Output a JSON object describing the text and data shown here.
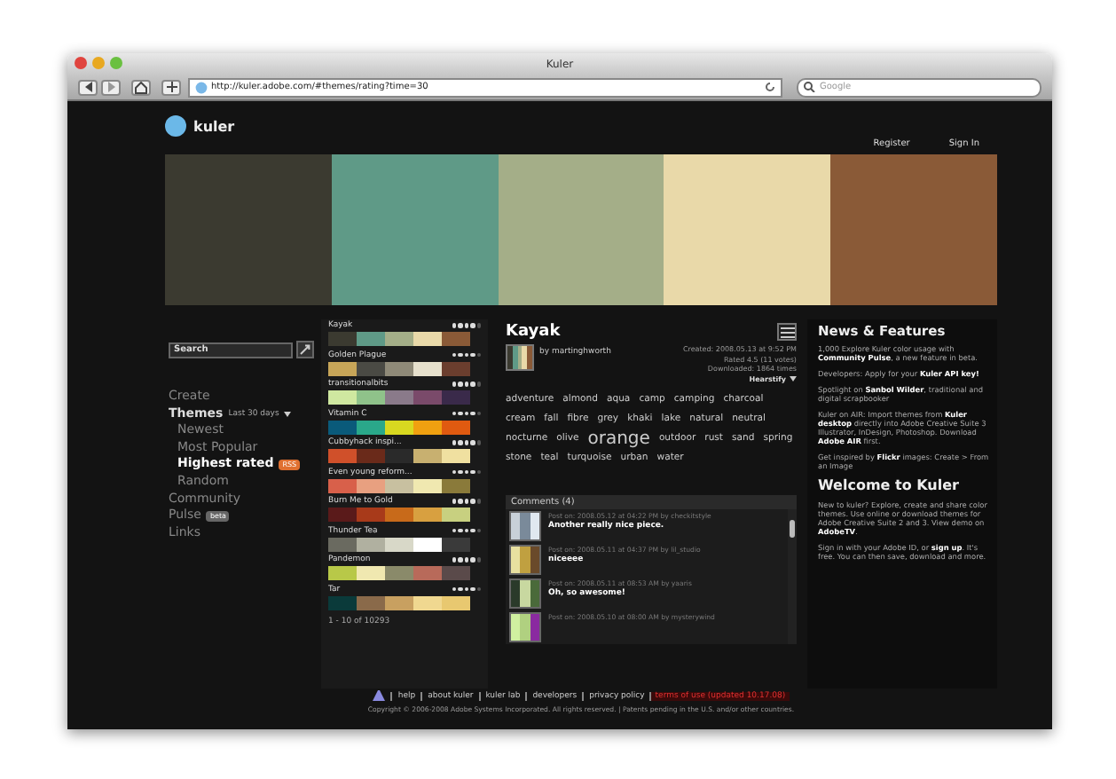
{
  "window": {
    "title": "Kuler"
  },
  "toolbar": {
    "url": "http://kuler.adobe.com/#themes/rating?time=30",
    "search_placeholder": "Google"
  },
  "header": {
    "logo": "kuler",
    "links": [
      "Register",
      "Sign In"
    ]
  },
  "hero_colors": [
    {
      "color": "#3b3a30"
    },
    {
      "color": "#5f9a87"
    },
    {
      "color": "#a4ae88"
    },
    {
      "color": "#e9d9a9"
    },
    {
      "color": "#8a5a37"
    }
  ],
  "sidebar": {
    "search": "Search",
    "nav": [
      {
        "label": "Create",
        "kind": "top",
        "selected": false
      },
      {
        "label": "Themes",
        "kind": "head",
        "selected": false,
        "note": "Last 30 days"
      },
      {
        "label": "Newest",
        "kind": "sub",
        "selected": false
      },
      {
        "label": "Most Popular",
        "kind": "sub",
        "selected": false
      },
      {
        "label": "Highest rated",
        "kind": "sub",
        "selected": true,
        "badge": "RSS"
      },
      {
        "label": "Random",
        "kind": "sub",
        "selected": false
      },
      {
        "label": "Community",
        "kind": "top",
        "selected": false
      },
      {
        "label": "Pulse",
        "kind": "top",
        "selected": false,
        "badge": "beta"
      },
      {
        "label": "Links",
        "kind": "top",
        "selected": false
      }
    ]
  },
  "themes": [
    {
      "name": "Kayak",
      "stars": 4,
      "colors": [
        {
          "color": "#3b3a30"
        },
        {
          "color": "#5f9a87"
        },
        {
          "color": "#a4ae88"
        },
        {
          "color": "#e9d9a9"
        },
        {
          "color": "#8a5a37"
        }
      ]
    },
    {
      "name": "Golden Plague",
      "stars": 4,
      "colors": [
        {
          "color": "#c7a558"
        },
        {
          "color": "#4a4a44"
        },
        {
          "color": "#8f8a78"
        },
        {
          "color": "#e6e0cc"
        },
        {
          "color": "#6b3e2e"
        }
      ]
    },
    {
      "name": "transitionalbits",
      "stars": 4,
      "colors": [
        {
          "color": "#cfe8a0"
        },
        {
          "color": "#8fc28a"
        },
        {
          "color": "#8a7a8a"
        },
        {
          "color": "#7a4a6a"
        },
        {
          "color": "#3a2a4a"
        }
      ]
    },
    {
      "name": "Vitamin C",
      "stars": 4,
      "colors": [
        {
          "color": "#0a5a7a"
        },
        {
          "color": "#2aa88a"
        },
        {
          "color": "#d8d820"
        },
        {
          "color": "#f0a010"
        },
        {
          "color": "#e05a10"
        }
      ]
    },
    {
      "name": "Cubbyhack inspi...",
      "stars": 4,
      "colors": [
        {
          "color": "#d0502a"
        },
        {
          "color": "#6a2a1a"
        },
        {
          "color": "#2a2a2a"
        },
        {
          "color": "#c8b070"
        },
        {
          "color": "#f0e0a0"
        }
      ]
    },
    {
      "name": "Even young reform...",
      "stars": 4,
      "colors": [
        {
          "color": "#d8604a"
        },
        {
          "color": "#e8a080"
        },
        {
          "color": "#c8c0a0"
        },
        {
          "color": "#f0e8b0"
        },
        {
          "color": "#8a7a3a"
        }
      ]
    },
    {
      "name": "Burn Me to Gold",
      "stars": 4,
      "colors": [
        {
          "color": "#5a1a1a"
        },
        {
          "color": "#a83a1a"
        },
        {
          "color": "#c86a1a"
        },
        {
          "color": "#d8a040"
        },
        {
          "color": "#c8d080"
        }
      ]
    },
    {
      "name": "Thunder Tea",
      "stars": 4,
      "colors": [
        {
          "color": "#6a6a60"
        },
        {
          "color": "#b0b0a0"
        },
        {
          "color": "#d8d8c8"
        },
        {
          "color": "#ffffff"
        },
        {
          "color": "#3a3a3a"
        }
      ]
    },
    {
      "name": "Pandemon",
      "stars": 4,
      "colors": [
        {
          "color": "#b8c848"
        },
        {
          "color": "#f0e8b0"
        },
        {
          "color": "#8a8a6a"
        },
        {
          "color": "#b86a5a"
        },
        {
          "color": "#5a4a4a"
        }
      ]
    },
    {
      "name": "Tar",
      "stars": 4,
      "colors": [
        {
          "color": "#0a3a3a"
        },
        {
          "color": "#8a6a4a"
        },
        {
          "color": "#c8a060"
        },
        {
          "color": "#f0d890"
        },
        {
          "color": "#e8c870"
        }
      ]
    }
  ],
  "pagination": "1 - 10 of 10293",
  "theme_detail": {
    "title": "Kayak",
    "author": "by martinghworth",
    "colors": [
      {
        "color": "#3b3a30"
      },
      {
        "color": "#5f9a87"
      },
      {
        "color": "#a4ae88"
      },
      {
        "color": "#e9d9a9"
      },
      {
        "color": "#8a5a37"
      }
    ],
    "meta": [
      "Created: 2008.05.13 at 9:52 PM",
      "Rated 4.5 (11 votes)",
      "Downloaded: 1864 times"
    ],
    "sort": "Hearstify",
    "tags": [
      {
        "text": "adventure",
        "emphasis": false
      },
      {
        "text": "almond",
        "emphasis": false
      },
      {
        "text": "aqua",
        "emphasis": false
      },
      {
        "text": "camp",
        "emphasis": false
      },
      {
        "text": "camping",
        "emphasis": false
      },
      {
        "text": "charcoal",
        "emphasis": false
      },
      {
        "text": "cream",
        "emphasis": false
      },
      {
        "text": "fall",
        "emphasis": false
      },
      {
        "text": "fibre",
        "emphasis": false
      },
      {
        "text": "grey",
        "emphasis": false
      },
      {
        "text": "khaki",
        "emphasis": false
      },
      {
        "text": "lake",
        "emphasis": false
      },
      {
        "text": "natural",
        "emphasis": false
      },
      {
        "text": "neutral",
        "emphasis": false
      },
      {
        "text": "nocturne",
        "emphasis": false
      },
      {
        "text": "olive",
        "emphasis": false
      },
      {
        "text": "orange",
        "emphasis": true
      },
      {
        "text": "outdoor",
        "emphasis": false
      },
      {
        "text": "rust",
        "emphasis": false
      },
      {
        "text": "sand",
        "emphasis": false
      },
      {
        "text": "spring",
        "emphasis": false
      },
      {
        "text": "stone",
        "emphasis": false
      },
      {
        "text": "teal",
        "emphasis": false
      },
      {
        "text": "turquoise",
        "emphasis": false
      },
      {
        "text": "urban",
        "emphasis": false
      },
      {
        "text": "water",
        "emphasis": false
      }
    ]
  },
  "comments": {
    "title": "Comments (4)",
    "items": [
      {
        "meta": "Post on: 2008.05.12 at 04:22 PM by checkitstyle",
        "text": "Another really nice piece.",
        "colors": [
          {
            "color": "#c8d0d8"
          },
          {
            "color": "#7a8a9a"
          },
          {
            "color": "#e0e8f0"
          }
        ]
      },
      {
        "meta": "Post on: 2008.05.11 at 04:37 PM by lil_studio",
        "text": "niceeee",
        "colors": [
          {
            "color": "#e8e0a0"
          },
          {
            "color": "#c0a040"
          },
          {
            "color": "#6a4a2a"
          }
        ]
      },
      {
        "meta": "Post on: 2008.05.11 at 08:53 AM by yaaris",
        "text": "Oh, so awesome!",
        "colors": [
          {
            "color": "#2a3a2a"
          },
          {
            "color": "#c8d8a0"
          },
          {
            "color": "#4a6a3a"
          }
        ]
      },
      {
        "meta": "Post on: 2008.05.10 at 08:00 AM by mysterywind",
        "colors": [
          {
            "color": "#d0f0a0"
          },
          {
            "color": "#b0d080"
          },
          {
            "color": "#8a2aa0"
          }
        ]
      }
    ]
  },
  "news": {
    "title": "News & Features",
    "items": [
      "1,000 Explore Kuler color usage with **Community Pulse**, a new feature in beta.",
      "Developers: Apply for your **Kuler API key!**",
      "Spotlight on **Sanbol Wilder**, traditional and digital scrapbooker",
      "Kuler on AIR: Import themes from **Kuler desktop** directly into Adobe Creative Suite 3 Illustrator, InDesign, Photoshop. Download **Adobe AIR** first.",
      "Get inspired by **Flickr** images: Create > From an Image"
    ],
    "welcome_title": "Welcome to Kuler",
    "welcome": [
      "New to kuler? Explore, create and share color themes. Use online or download themes for Adobe Creative Suite 2 and 3. View demo on **AdobeTV**.",
      "Sign in with your Adobe ID, or **sign up**. It's free. You can then save, download and more."
    ]
  },
  "footer": {
    "links": [
      {
        "text": "help",
        "kind": "plain"
      },
      {
        "text": "about kuler",
        "kind": "plain"
      },
      {
        "text": "kuler lab",
        "kind": "plain"
      },
      {
        "text": "developers",
        "kind": "plain"
      },
      {
        "text": "privacy policy",
        "kind": "plain"
      },
      {
        "text": "terms of use (updated 10.17.08)",
        "kind": "alert"
      }
    ],
    "copyright": "Copyright © 2006-2008 Adobe Systems Incorporated. All rights reserved. | Patents pending in the U.S. and/or other countries."
  }
}
